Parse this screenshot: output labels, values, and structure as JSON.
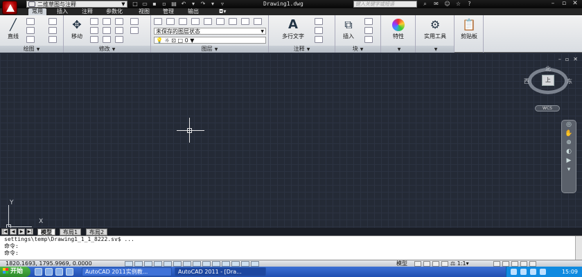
{
  "title_bar": {
    "workspace": "二维草图与注释",
    "document_title": "Drawing1.dwg",
    "search_placeholder": "键入关键字或短语"
  },
  "ribbon_tabs": [
    "常用",
    "插入",
    "注释",
    "参数化",
    "视图",
    "管理",
    "输出"
  ],
  "ribbon": {
    "draw_panel": {
      "line_label": "直线",
      "panel_label": "绘图"
    },
    "modify_panel": {
      "move_label": "移动",
      "panel_label": "修改"
    },
    "layer_panel": {
      "state": "未保存的图层状态",
      "current_layer": "0",
      "panel_label": "图层"
    },
    "annotation_panel": {
      "mtext_label": "多行文字",
      "panel_label": "注释"
    },
    "block_panel": {
      "insert_label": "插入",
      "panel_label": "块"
    },
    "properties_label": "特性",
    "utilities_label": "实用工具",
    "clipboard_label": "剪贴板"
  },
  "viewcube": {
    "north": "北",
    "south": "南",
    "east": "东",
    "west": "西",
    "face": "上",
    "wcs": "WCS"
  },
  "ucs": {
    "x": "X",
    "y": "Y"
  },
  "layout_tabs": [
    "模型",
    "布局1",
    "布局2"
  ],
  "command": {
    "history": "settings\\temp\\Drawing1_1_1_8222.sv$ ...",
    "line1": "命令:",
    "line2": "命令:"
  },
  "status": {
    "coords": "1820.1693, 1795.9969, 0.0000",
    "model": "模型",
    "scale": "1:1"
  },
  "taskbar": {
    "start": "开始",
    "task1": "AutoCAD 2011实例教...",
    "task2": "AutoCAD 2011 - [Dra...",
    "clock": "15:09"
  },
  "colors": {
    "canvas": "#242a36",
    "taskbar": "#245edb",
    "start": "#3c9c37"
  }
}
